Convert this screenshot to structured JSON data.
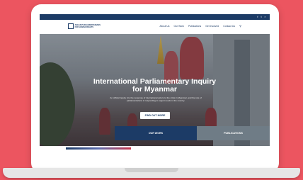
{
  "topbar": {
    "icons": [
      "facebook-icon",
      "twitter-icon",
      "rss-icon"
    ],
    "glyphs": [
      "f",
      "t",
      "r"
    ]
  },
  "logo": {
    "line1": "ASEAN PARLIAMENTARIANS",
    "line2": "FOR HUMAN RIGHTS"
  },
  "nav": {
    "items": [
      "About Us",
      "Our Work",
      "Publications",
      "Get Involved",
      "Contact Us"
    ]
  },
  "hero": {
    "title_line1": "International Parliamentary Inquiry",
    "title_line2": "for Myanmar",
    "subtitle": "An official inquiry into the response of international actors to the crisis in Myanmar, and the role of parliamentarians in responding to urgent needs in the country.",
    "cta": "FIND OUT MORE"
  },
  "tabs": {
    "our_work": "OUR WORK",
    "publications": "PUBLICATIONS"
  },
  "colors": {
    "background": "#ec5560",
    "navy": "#1c3b66",
    "slate": "#6f7c86"
  }
}
